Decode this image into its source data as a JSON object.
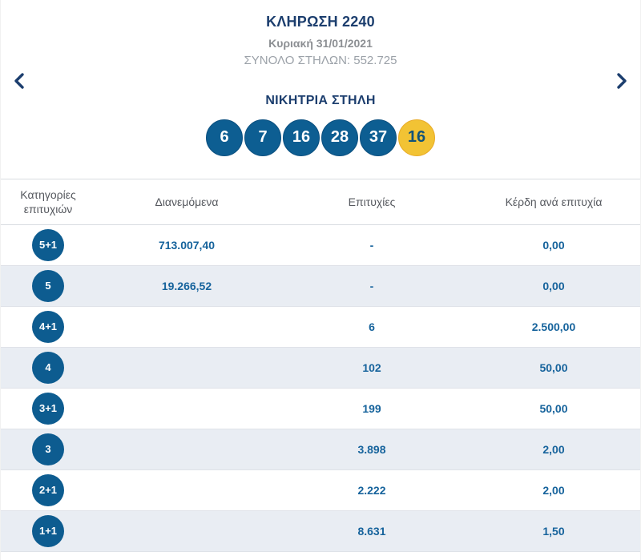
{
  "header": {
    "title": "ΚΛΗΡΩΣΗ 2240",
    "date": "Κυριακή 31/01/2021",
    "total_columns": "ΣΥΝΟΛΟ ΣΤΗΛΩΝ: 552.725"
  },
  "carousel": {
    "prev_icon": "chevron-left",
    "next_icon": "chevron-right"
  },
  "winning": {
    "title": "ΝΙΚΗΤΡΙΑ ΣΤΗΛΗ",
    "numbers": [
      "6",
      "7",
      "16",
      "28",
      "37"
    ],
    "joker": "16"
  },
  "table": {
    "headers": [
      "Κατηγορίες επιτυχιών",
      "Διανεμόμενα",
      "Επιτυχίες",
      "Κέρδη ανά επιτυχία"
    ],
    "rows": [
      {
        "category": "5+1",
        "dividend": "713.007,40",
        "winners": "-",
        "prize": "0,00"
      },
      {
        "category": "5",
        "dividend": "19.266,52",
        "winners": "-",
        "prize": "0,00"
      },
      {
        "category": "4+1",
        "dividend": "",
        "winners": "6",
        "prize": "2.500,00"
      },
      {
        "category": "4",
        "dividend": "",
        "winners": "102",
        "prize": "50,00"
      },
      {
        "category": "3+1",
        "dividend": "",
        "winners": "199",
        "prize": "50,00"
      },
      {
        "category": "3",
        "dividend": "",
        "winners": "3.898",
        "prize": "2,00"
      },
      {
        "category": "2+1",
        "dividend": "",
        "winners": "2.222",
        "prize": "2,00"
      },
      {
        "category": "1+1",
        "dividend": "",
        "winners": "8.631",
        "prize": "1,50"
      }
    ]
  },
  "colors": {
    "navy_title": "#1c3e6e",
    "ball_blue": "#0d5e92",
    "ball_yellow": "#f2c334",
    "value_blue": "#16639c",
    "alt_row_bg": "#e9edf3",
    "muted_gray": "#9ba1a8"
  }
}
